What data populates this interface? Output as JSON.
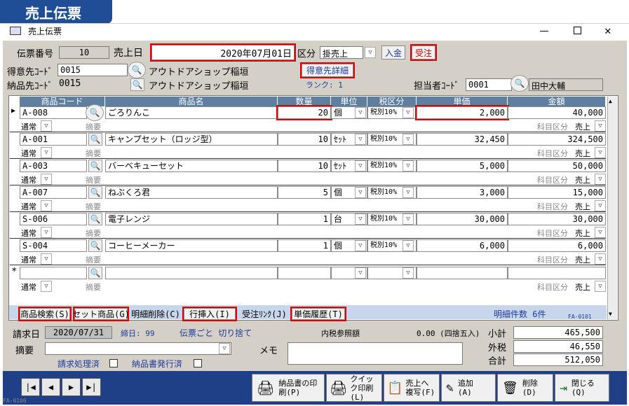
{
  "banner": "売上伝票",
  "window": {
    "title": "売上伝票"
  },
  "header": {
    "slip_no_label": "伝票番号",
    "slip_no": "10",
    "sales_date_label": "売上日",
    "sales_date": "2020年07月01日",
    "kubun_label": "区分",
    "kubun_value": "掛売上",
    "nyukin_button": "入金",
    "juchu_button": "受注",
    "customer_code_label": "得意先ｺｰﾄﾞ",
    "customer_code": "0015",
    "customer_name": "アウトドアショップ稲垣",
    "customer_detail_button": "得意先詳細",
    "delivery_code_label": "納品先ｺｰﾄﾞ",
    "delivery_code": "0015",
    "delivery_name": "アウトドアショップ稲垣",
    "rank_label": "ランク: 1",
    "staff_code_label": "担当者ｺｰﾄﾞ",
    "staff_code": "0001",
    "staff_name": "田中大輔"
  },
  "columns": {
    "code": "商品コード",
    "name": "商品名",
    "qty": "数量",
    "unit": "単位",
    "tax": "税区分",
    "price": "単価",
    "amount": "金額"
  },
  "rows": [
    {
      "code": "A-008",
      "name": "ごろりんこ",
      "qty": "20",
      "unit": "個",
      "tax": "税別10%",
      "price": "2,000",
      "amount": "40,000",
      "type": "通常",
      "memo": "摘要",
      "subject_label": "科目区分",
      "subject": "売上"
    },
    {
      "code": "A-001",
      "name": "キャンプセット（ロッジ型）",
      "qty": "10",
      "unit": "ｾｯﾄ",
      "tax": "税別10%",
      "price": "32,450",
      "amount": "324,500",
      "type": "通常",
      "memo": "摘要",
      "subject_label": "科目区分",
      "subject": "売上"
    },
    {
      "code": "A-003",
      "name": "バーベキューセット",
      "qty": "10",
      "unit": "ｾｯﾄ",
      "tax": "税別10%",
      "price": "5,000",
      "amount": "50,000",
      "type": "通常",
      "memo": "摘要",
      "subject_label": "科目区分",
      "subject": "売上"
    },
    {
      "code": "A-007",
      "name": "ねぶくろ君",
      "qty": "5",
      "unit": "個",
      "tax": "税別10%",
      "price": "3,000",
      "amount": "15,000",
      "type": "通常",
      "memo": "摘要",
      "subject_label": "科目区分",
      "subject": "売上"
    },
    {
      "code": "S-006",
      "name": "電子レンジ",
      "qty": "1",
      "unit": "台",
      "tax": "税別10%",
      "price": "30,000",
      "amount": "30,000",
      "type": "通常",
      "memo": "摘要",
      "subject_label": "科目区分",
      "subject": "売上"
    },
    {
      "code": "S-004",
      "name": "コーヒーメーカー",
      "qty": "1",
      "unit": "個",
      "tax": "税別10%",
      "price": "6,000",
      "amount": "6,000",
      "type": "通常",
      "memo": "摘要",
      "subject_label": "科目区分",
      "subject": "売上"
    }
  ],
  "new_row": {
    "type": "通常",
    "memo": "摘要",
    "subject_label": "科目区分",
    "subject": "売上"
  },
  "toolbar": {
    "product_search": "商品検索(S)",
    "set_product": "セット商品(G)",
    "delete_detail": "明細削除(C)",
    "insert_row": "行挿入(I)",
    "order_link": "受注ﾘﾝｸ(J)",
    "unit_history": "単価履歴(T)",
    "detail_count": "明細件数 6件",
    "form_id": "FA-0101"
  },
  "footer": {
    "billing_date_label": "請求日",
    "billing_date": "2020/07/31",
    "closing_day": "締日: 99",
    "rounding": "伝票ごと 切り捨て",
    "tax_ref_label": "内税参照額",
    "tax_ref_value": "0.00 (四捨五入)",
    "subtotal_label": "小計",
    "subtotal": "465,500",
    "tax_label": "外税",
    "tax": "46,550",
    "total_label": "合計",
    "total": "512,050",
    "remarks_label": "摘要",
    "memo_label": "メモ",
    "billing_done_label": "請求処理済",
    "delivery_issued_label": "納品書発行済"
  },
  "actions": {
    "print_delivery": "納品書の印刷(P)",
    "quick_print": "クイック印刷(L)",
    "copy_to_sales": "売上へ複写(F)",
    "add": "追加(A)",
    "delete": "削除(D)",
    "close": "閉じる(Q)"
  },
  "corner_id": "FA-0100"
}
